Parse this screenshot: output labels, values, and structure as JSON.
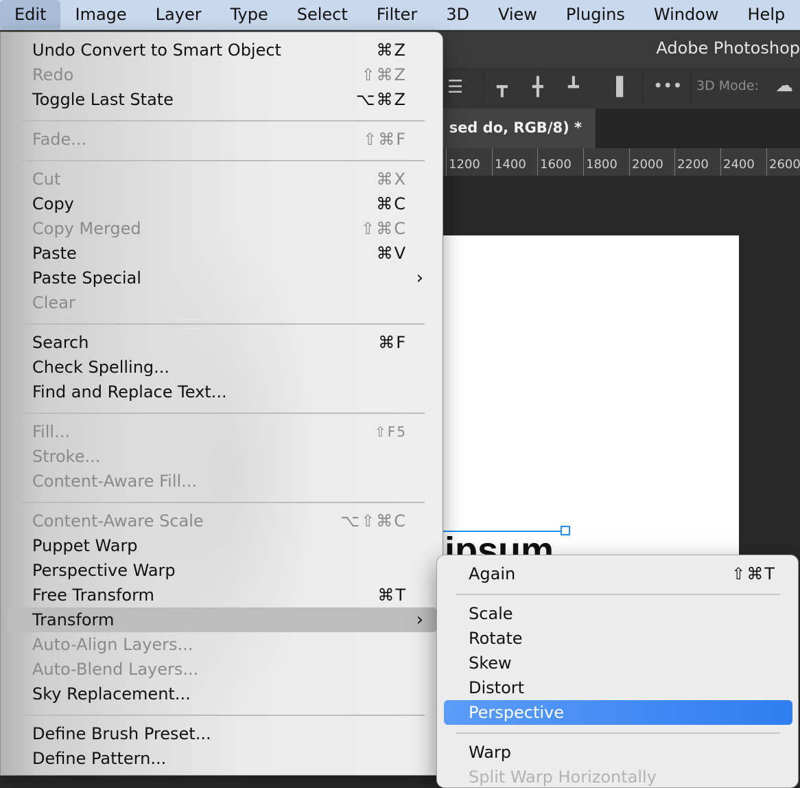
{
  "menubar": {
    "items": [
      "Edit",
      "Image",
      "Layer",
      "Type",
      "Select",
      "Filter",
      "3D",
      "View",
      "Plugins",
      "Window",
      "Help"
    ],
    "active_item": "Edit"
  },
  "photoshop": {
    "title": "Adobe Photoshop",
    "mode_label": "3D Mode:",
    "tab_label": ", sed do, RGB/8) *",
    "ruler_ticks": [
      "1200",
      "1400",
      "1600",
      "1800",
      "2000",
      "2200",
      "2400",
      "2600"
    ],
    "canvas_text": "ipsum"
  },
  "edit_menu": {
    "items": [
      {
        "label": "Undo Convert to Smart Object",
        "shortcut": "⌘Z",
        "enabled": true
      },
      {
        "label": "Redo",
        "shortcut": "⇧⌘Z",
        "enabled": false
      },
      {
        "label": "Toggle Last State",
        "shortcut": "⌥⌘Z",
        "enabled": true
      },
      {
        "label": "Fade...",
        "shortcut": "⇧⌘F",
        "enabled": false
      },
      {
        "label": "Cut",
        "shortcut": "⌘X",
        "enabled": false
      },
      {
        "label": "Copy",
        "shortcut": "⌘C",
        "enabled": true
      },
      {
        "label": "Copy Merged",
        "shortcut": "⇧⌘C",
        "enabled": false
      },
      {
        "label": "Paste",
        "shortcut": "⌘V",
        "enabled": true
      },
      {
        "label": "Paste Special",
        "submenu": true,
        "enabled": true
      },
      {
        "label": "Clear",
        "enabled": false
      },
      {
        "label": "Search",
        "shortcut": "⌘F",
        "enabled": true
      },
      {
        "label": "Check Spelling...",
        "enabled": true
      },
      {
        "label": "Find and Replace Text...",
        "enabled": true
      },
      {
        "label": "Fill...",
        "shortcut": "⇧F5",
        "enabled": false
      },
      {
        "label": "Stroke...",
        "enabled": false
      },
      {
        "label": "Content-Aware Fill...",
        "enabled": false
      },
      {
        "label": "Content-Aware Scale",
        "shortcut": "⌥⇧⌘C",
        "enabled": false
      },
      {
        "label": "Puppet Warp",
        "enabled": true
      },
      {
        "label": "Perspective Warp",
        "enabled": true
      },
      {
        "label": "Free Transform",
        "shortcut": "⌘T",
        "enabled": true
      },
      {
        "label": "Transform",
        "submenu": true,
        "enabled": true,
        "highlighted": true
      },
      {
        "label": "Auto-Align Layers...",
        "enabled": false
      },
      {
        "label": "Auto-Blend Layers...",
        "enabled": false
      },
      {
        "label": "Sky Replacement...",
        "enabled": true
      },
      {
        "label": "Define Brush Preset...",
        "enabled": true
      },
      {
        "label": "Define Pattern...",
        "enabled": true
      }
    ]
  },
  "transform_submenu": {
    "items": [
      {
        "label": "Again",
        "shortcut": "⇧⌘T",
        "enabled": true
      },
      {
        "label": "Scale",
        "enabled": true
      },
      {
        "label": "Rotate",
        "enabled": true
      },
      {
        "label": "Skew",
        "enabled": true
      },
      {
        "label": "Distort",
        "enabled": true
      },
      {
        "label": "Perspective",
        "enabled": true,
        "selected": true
      },
      {
        "label": "Warp",
        "enabled": true
      },
      {
        "label": "Split Warp Horizontally",
        "enabled": false
      }
    ]
  },
  "colors": {
    "menubar_bg": "#c9d8ec",
    "selection_blue": "#2f7df0",
    "transform_handle": "#1e8ff0"
  }
}
